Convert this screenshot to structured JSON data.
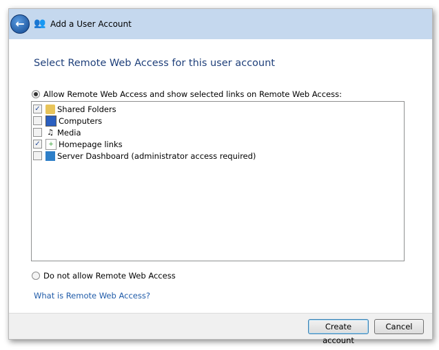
{
  "header": {
    "title": "Add a User Account",
    "back_icon": "back-arrow-icon",
    "user_icon": "users-icon"
  },
  "heading": "Select Remote Web Access for this user account",
  "allow_option": {
    "label": "Allow Remote Web Access and show selected links on Remote Web Access:",
    "selected": true
  },
  "links": [
    {
      "label": "Shared Folders",
      "checked": true,
      "icon": "folder-icon"
    },
    {
      "label": "Computers",
      "checked": false,
      "icon": "computer-icon"
    },
    {
      "label": "Media",
      "checked": false,
      "icon": "media-icon"
    },
    {
      "label": "Homepage links",
      "checked": true,
      "icon": "homepage-links-icon"
    },
    {
      "label": "Server Dashboard (administrator access required)",
      "checked": false,
      "icon": "dashboard-icon"
    }
  ],
  "deny_option": {
    "label": "Do not allow Remote Web Access",
    "selected": false
  },
  "help_link": "What is Remote Web Access?",
  "buttons": {
    "create": "Create account",
    "cancel": "Cancel"
  }
}
